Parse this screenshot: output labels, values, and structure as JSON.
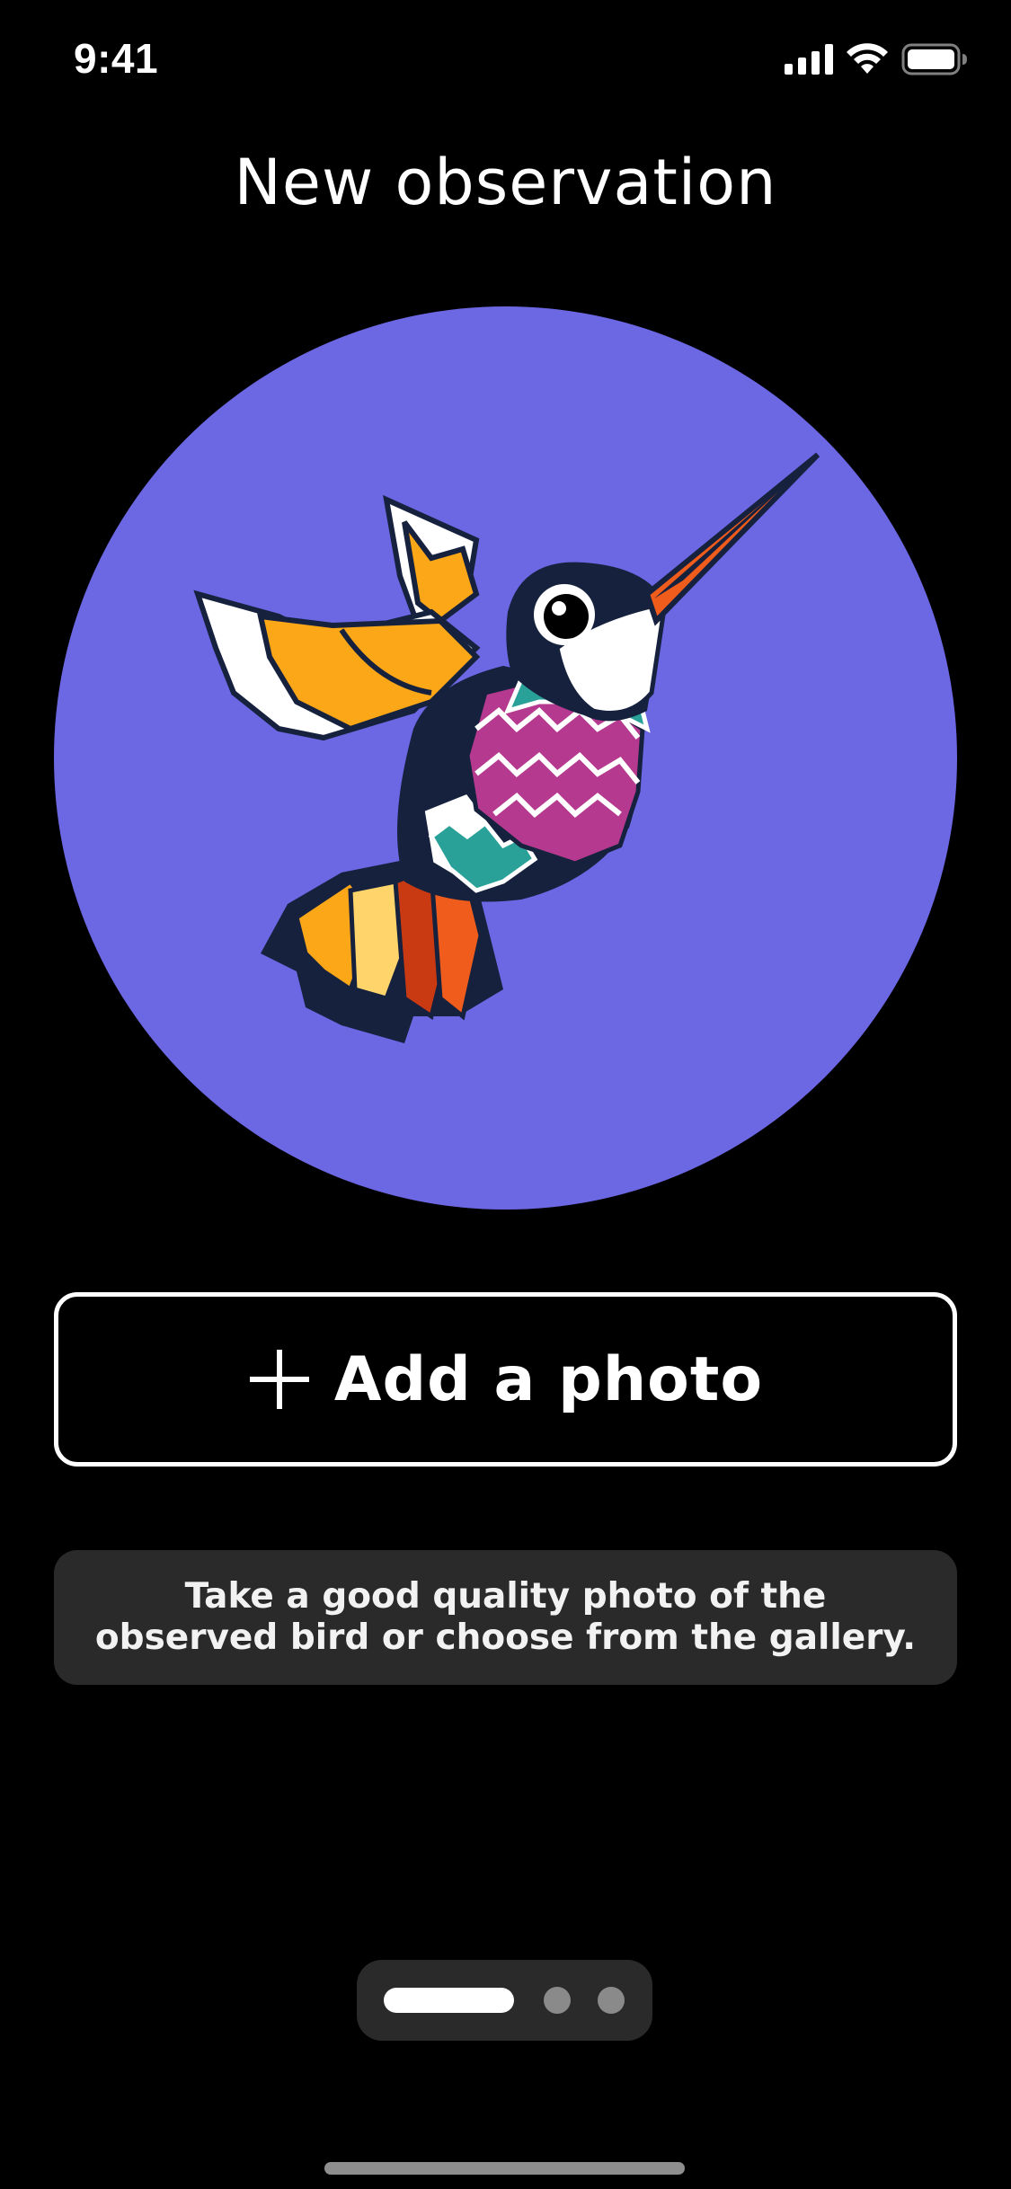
{
  "status_bar": {
    "time": "9:41",
    "icons": [
      "cellular-signal-icon",
      "wifi-icon",
      "battery-icon"
    ]
  },
  "header": {
    "title": "New observation"
  },
  "hero": {
    "illustration": "hummingbird-illustration",
    "background_color": "#6c67e3"
  },
  "actions": {
    "add_photo_label": "Add a photo",
    "add_photo_icon": "plus-icon"
  },
  "hint": {
    "text": "Take a good quality photo of the observed bird or choose from the gallery."
  },
  "pager": {
    "total_steps": 3,
    "current_step": 1
  },
  "colors": {
    "background": "#000000",
    "accent": "#6c67e3",
    "surface": "#2a2a2a",
    "text": "#ffffff"
  }
}
